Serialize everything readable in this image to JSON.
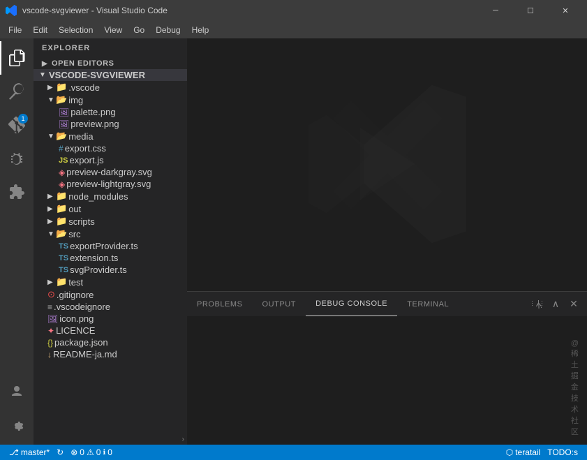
{
  "titleBar": {
    "icon": "vscode",
    "title": "vscode-svgviewer - Visual Studio Code",
    "minBtn": "─",
    "maxBtn": "☐",
    "closeBtn": "✕"
  },
  "menuBar": {
    "items": [
      "File",
      "Edit",
      "Selection",
      "View",
      "Go",
      "Debug",
      "Help"
    ]
  },
  "activityBar": {
    "icons": [
      {
        "name": "explorer-icon",
        "symbol": "⎘",
        "active": true,
        "badge": null
      },
      {
        "name": "search-icon",
        "symbol": "🔍",
        "active": false,
        "badge": null
      },
      {
        "name": "git-icon",
        "symbol": "⌥",
        "active": false,
        "badge": "1"
      },
      {
        "name": "debug-icon",
        "symbol": "🐛",
        "active": false,
        "badge": null
      },
      {
        "name": "extensions-icon",
        "symbol": "⊞",
        "active": false,
        "badge": null
      }
    ],
    "bottomIcons": [
      {
        "name": "account-icon",
        "symbol": "👤"
      },
      {
        "name": "settings-icon",
        "symbol": "⚙"
      }
    ]
  },
  "sidebar": {
    "header": "Explorer",
    "sections": [
      {
        "label": "Open Editors",
        "expanded": false,
        "items": []
      },
      {
        "label": "VSCODE-SVGVIEWER",
        "expanded": true,
        "items": [
          {
            "indent": 1,
            "type": "folder",
            "label": ".vscode",
            "expanded": false
          },
          {
            "indent": 1,
            "type": "folder",
            "label": "img",
            "expanded": true
          },
          {
            "indent": 2,
            "type": "png",
            "label": "palette.png"
          },
          {
            "indent": 2,
            "type": "png",
            "label": "preview.png"
          },
          {
            "indent": 1,
            "type": "folder",
            "label": "media",
            "expanded": true
          },
          {
            "indent": 2,
            "type": "css",
            "label": "export.css"
          },
          {
            "indent": 2,
            "type": "js",
            "label": "export.js"
          },
          {
            "indent": 2,
            "type": "svg",
            "label": "preview-darkgray.svg"
          },
          {
            "indent": 2,
            "type": "svg",
            "label": "preview-lightgray.svg"
          },
          {
            "indent": 1,
            "type": "folder",
            "label": "node_modules",
            "expanded": false
          },
          {
            "indent": 1,
            "type": "folder",
            "label": "out",
            "expanded": false
          },
          {
            "indent": 1,
            "type": "folder",
            "label": "scripts",
            "expanded": false
          },
          {
            "indent": 1,
            "type": "folder",
            "label": "src",
            "expanded": true
          },
          {
            "indent": 2,
            "type": "ts",
            "label": "exportProvider.ts"
          },
          {
            "indent": 2,
            "type": "ts",
            "label": "extension.ts"
          },
          {
            "indent": 2,
            "type": "ts",
            "label": "svgProvider.ts"
          },
          {
            "indent": 1,
            "type": "folder",
            "label": "test",
            "expanded": false
          },
          {
            "indent": 1,
            "type": "git",
            "label": ".gitignore"
          },
          {
            "indent": 1,
            "type": "generic",
            "label": ".vscodeignore"
          },
          {
            "indent": 1,
            "type": "png",
            "label": "icon.png"
          },
          {
            "indent": 1,
            "type": "licence",
            "label": "LICENCE"
          },
          {
            "indent": 1,
            "type": "json",
            "label": "package.json"
          },
          {
            "indent": 1,
            "type": "md",
            "label": "README-ja.md"
          }
        ]
      }
    ]
  },
  "panel": {
    "tabs": [
      "PROBLEMS",
      "OUTPUT",
      "DEBUG CONSOLE",
      "TERMINAL"
    ],
    "activeTab": "DEBUG CONSOLE"
  },
  "statusBar": {
    "left": [
      {
        "icon": "branch-icon",
        "text": "master*"
      },
      {
        "icon": "sync-icon",
        "text": ""
      },
      {
        "icon": "error-icon",
        "text": "0"
      },
      {
        "icon": "warning-icon",
        "text": "0"
      },
      {
        "icon": "info-icon",
        "text": "0"
      }
    ],
    "right": [
      {
        "text": "⬡ teratail"
      },
      {
        "text": "TODO:s"
      }
    ],
    "watermark": "@稀土掘金技术社区"
  }
}
